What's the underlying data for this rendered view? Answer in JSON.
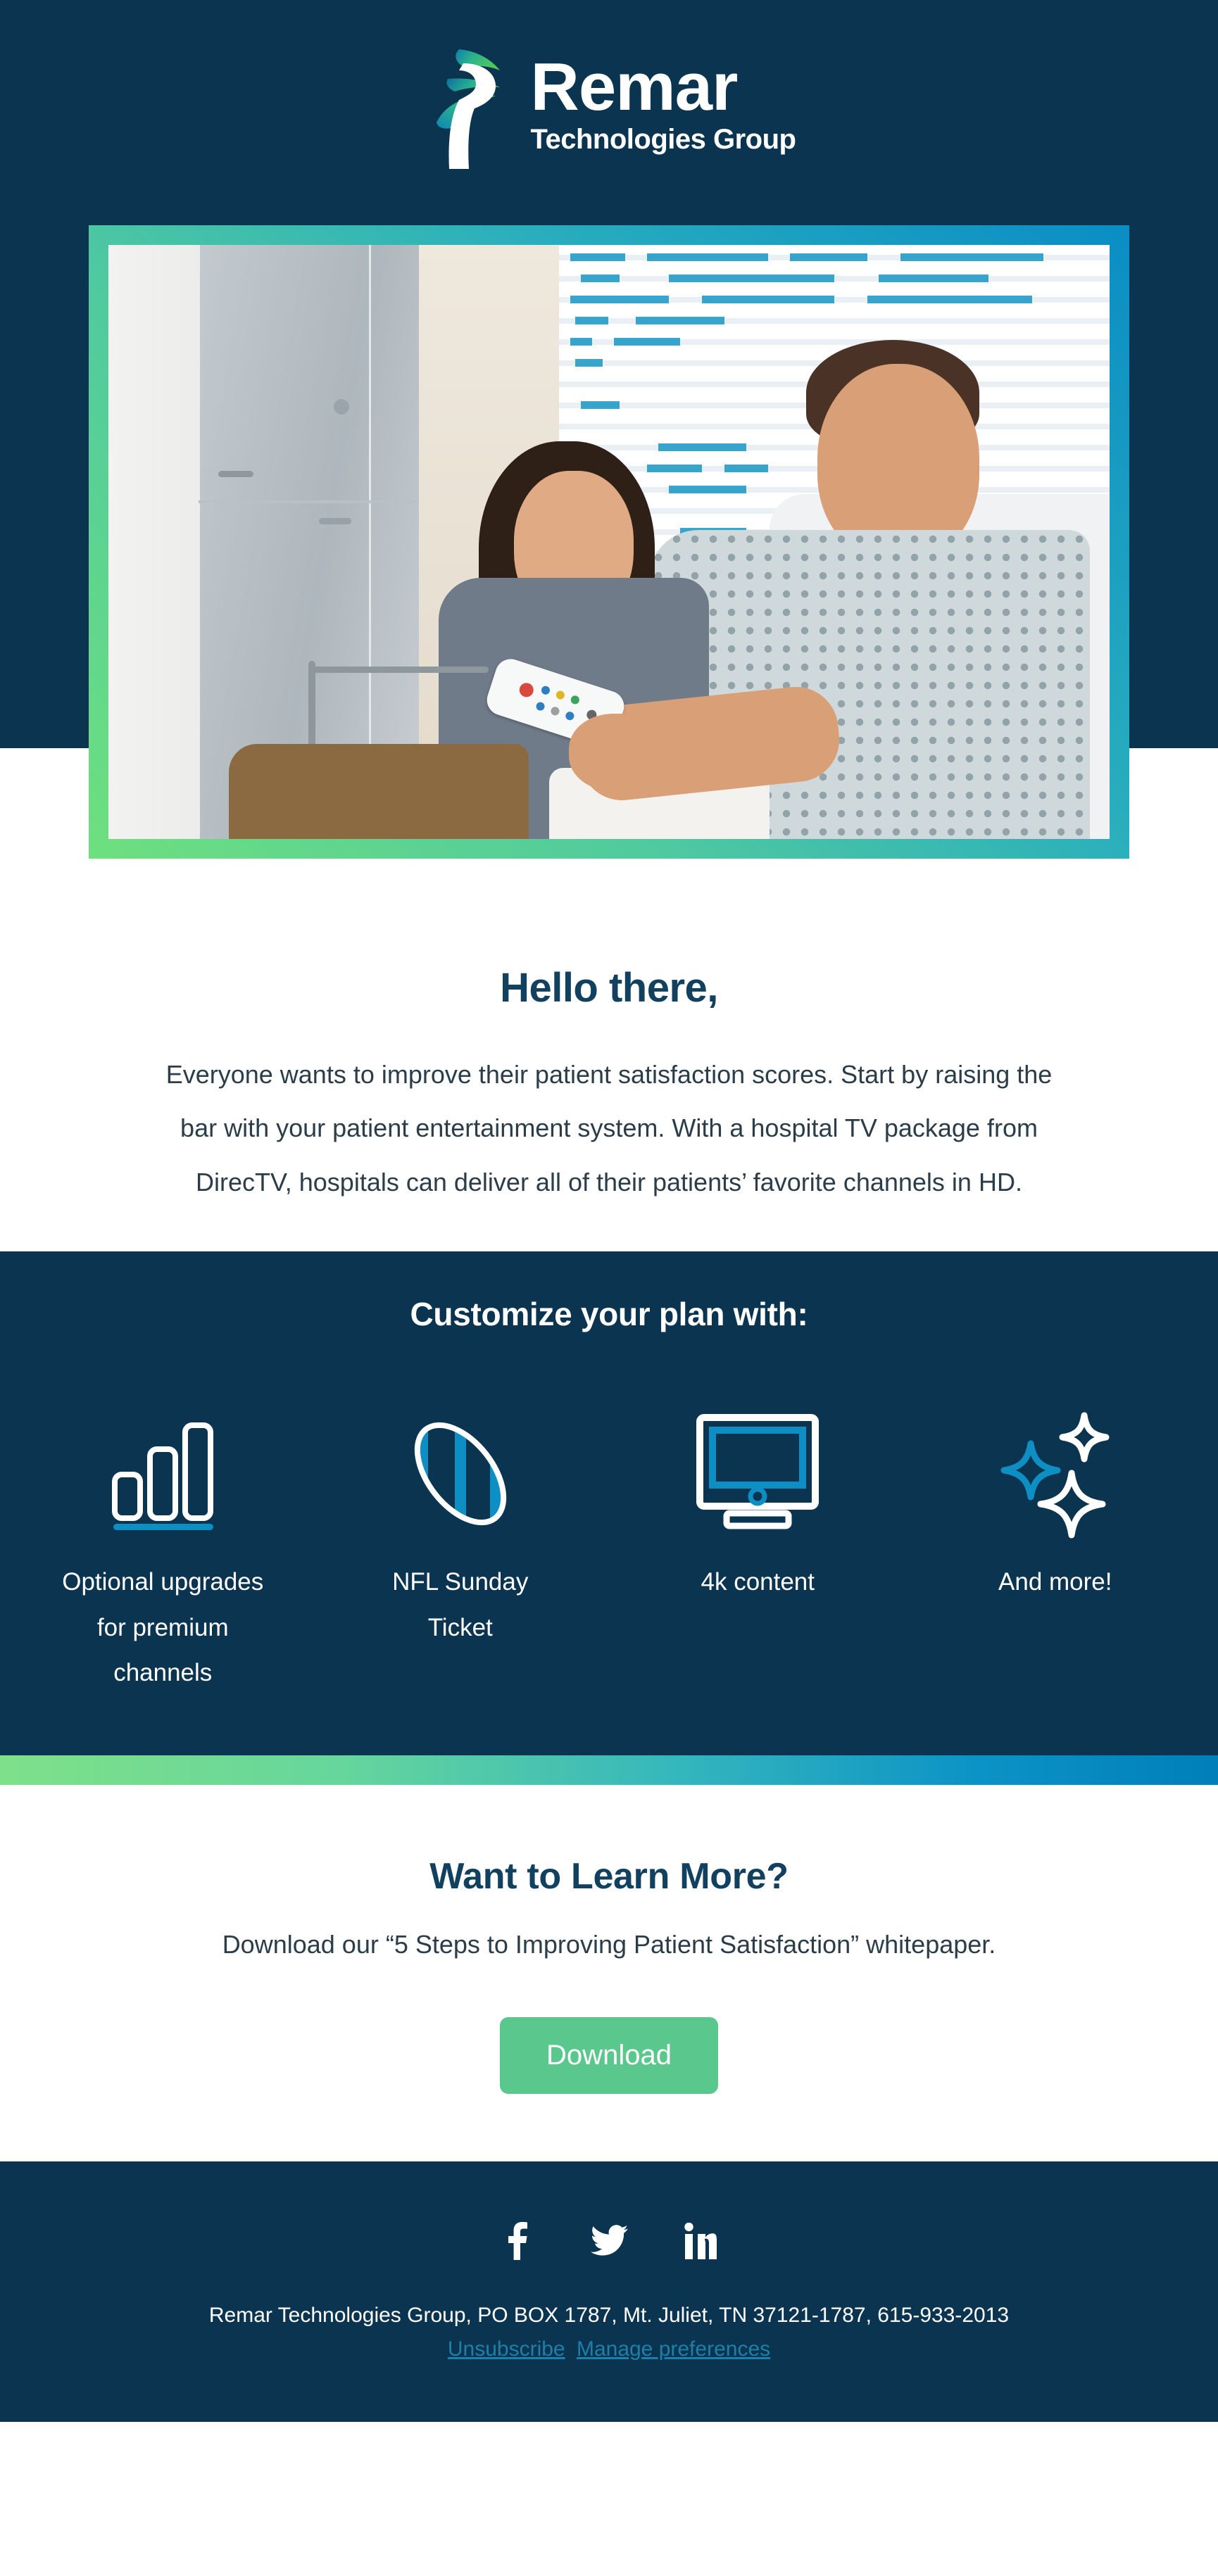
{
  "brand": {
    "name": "Remar",
    "tagline": "Technologies Group",
    "logo_icon": "remar-r-swoosh-logo",
    "colors": {
      "navy": "#0B3450",
      "heading_navy": "#12405F",
      "accent_blue": "#0E8FC4",
      "accent_green": "#5AC78C",
      "gradient_start": "#7EE089",
      "gradient_end": "#007FB9",
      "link_blue": "#1E7FA8"
    }
  },
  "hero": {
    "image_alt": "Woman and hospital patient smiling while holding a TV remote in a hospital room"
  },
  "greeting": {
    "title": "Hello there,",
    "body_lines": [
      "Everyone wants to improve their patient satisfaction scores. Start by raising the",
      "bar with your patient entertainment system. With a hospital TV package from",
      "DirecTV, hospitals can deliver all of their patients’ favorite channels in HD."
    ]
  },
  "features": {
    "title": "Customize your plan with:",
    "items": [
      {
        "icon": "bar-chart-icon",
        "label": "Optional upgrades for premium channels"
      },
      {
        "icon": "football-icon",
        "label": "NFL Sunday Ticket"
      },
      {
        "icon": "television-icon",
        "label": "4k content"
      },
      {
        "icon": "sparkles-icon",
        "label": "And more!"
      }
    ]
  },
  "cta": {
    "title": "Want to Learn More?",
    "subtitle": "Download our “5 Steps to Improving Patient Satisfaction” whitepaper.",
    "button_label": "Download"
  },
  "footer": {
    "social": [
      {
        "icon": "facebook-icon",
        "name": "Facebook"
      },
      {
        "icon": "twitter-icon",
        "name": "Twitter"
      },
      {
        "icon": "linkedin-icon",
        "name": "LinkedIn"
      }
    ],
    "address": "Remar Technologies Group, PO BOX 1787, Mt. Juliet, TN 37121-1787, 615-933-2013",
    "unsubscribe_label": "Unsubscribe",
    "preferences_label": "Manage preferences"
  }
}
